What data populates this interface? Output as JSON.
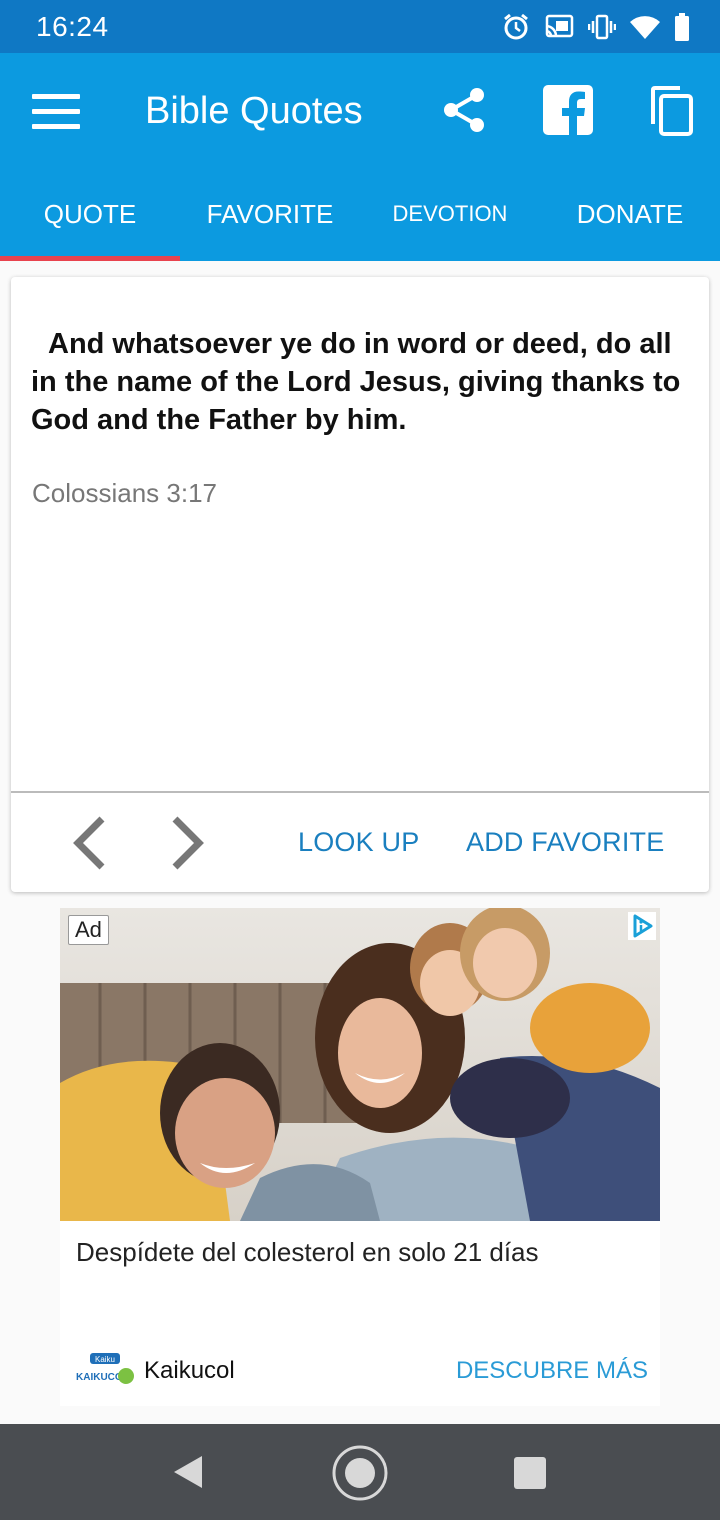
{
  "status_bar": {
    "time": "16:24"
  },
  "app_bar": {
    "title": "Bible Quotes"
  },
  "tabs": [
    {
      "label": "QUOTE"
    },
    {
      "label": "FAVORITE"
    },
    {
      "label": "DEVOTION"
    },
    {
      "label": "DONATE"
    }
  ],
  "quote": {
    "text": "And whatsoever ye do in word or deed, do all in the name of the Lord Jesus, giving thanks to God and the Father by him.",
    "reference": "Colossians 3:17"
  },
  "actions": {
    "look_up": "LOOK UP",
    "add_favorite": "ADD FAVORITE"
  },
  "ad": {
    "badge": "Ad",
    "headline": "Despídete del colesterol en solo 21 días",
    "brand": "Kaikucol",
    "cta": "DESCUBRE MÁS",
    "logo_text": "KAIKUCOL"
  },
  "colors": {
    "app_bar": "#0c9ae0",
    "status_bar": "#0f78c4",
    "tab_indicator": "#e8434e",
    "action_text": "#1a7fbf"
  }
}
